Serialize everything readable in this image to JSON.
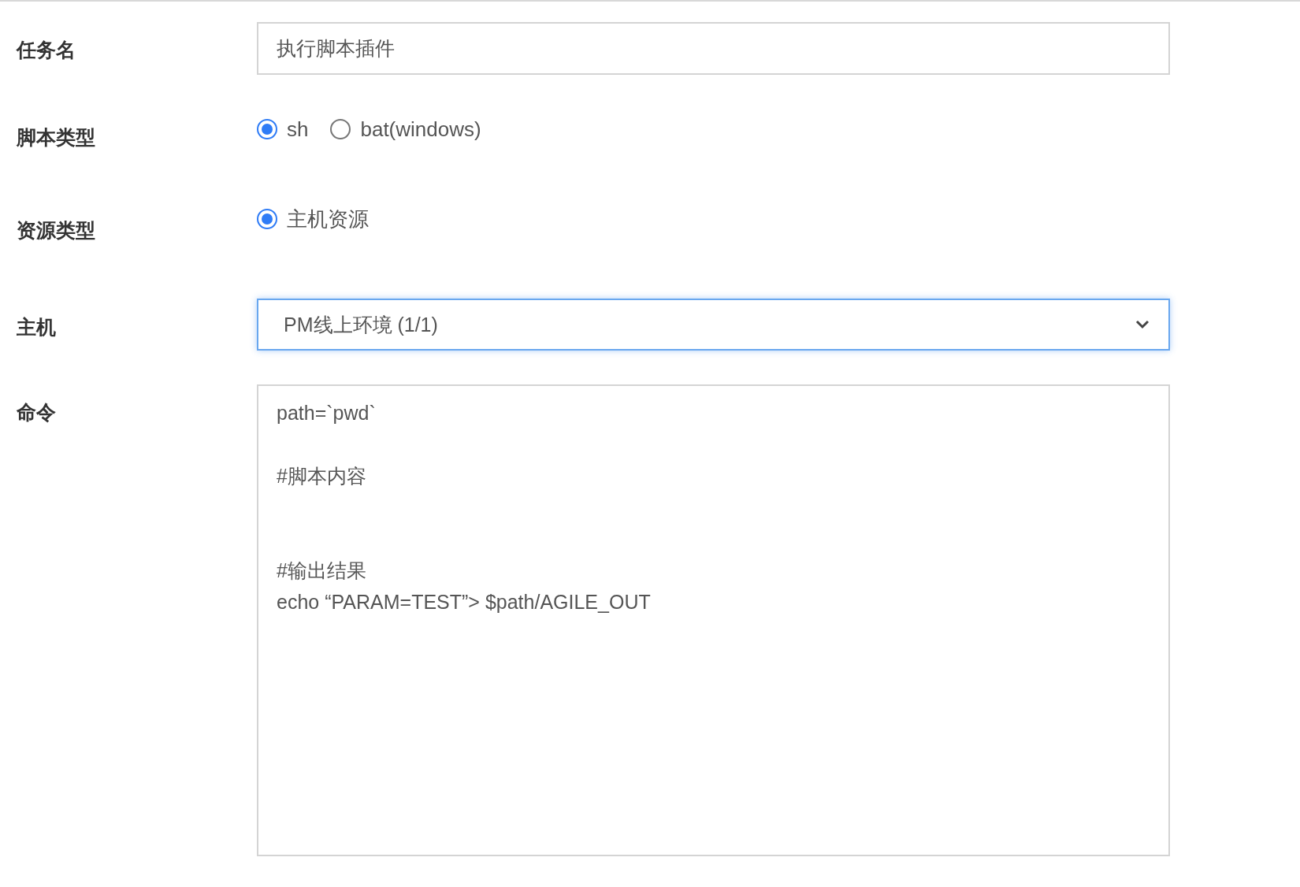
{
  "fields": [
    {
      "kind": "text",
      "label": "任务名",
      "value": "执行脚本插件"
    },
    {
      "kind": "radio",
      "label": "脚本类型",
      "options": [
        {
          "label": "sh",
          "selected": true
        },
        {
          "label": "bat(windows)",
          "selected": false
        }
      ]
    },
    {
      "kind": "radio",
      "label": "资源类型",
      "options": [
        {
          "label": "主机资源",
          "selected": true
        }
      ]
    },
    {
      "kind": "select",
      "label": "主机",
      "value": "PM线上环境 (1/1)",
      "focused": true
    },
    {
      "kind": "textarea",
      "label": "命令",
      "value": "path=`pwd`\n\n#脚本内容\n\n\n#输出结果\necho “PARAM=TEST”> $path/AGILE_OUT"
    }
  ]
}
